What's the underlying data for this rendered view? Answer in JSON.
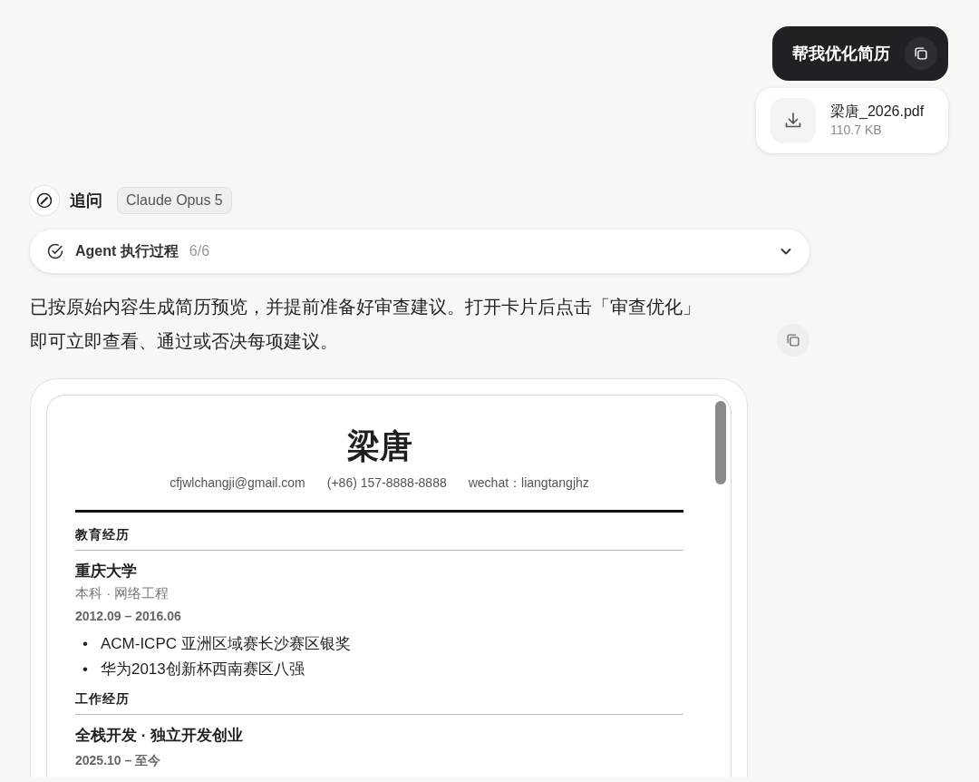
{
  "user_message": {
    "text": "帮我优化简历"
  },
  "attachment": {
    "name": "梁唐_2026.pdf",
    "size": "110.7 KB"
  },
  "assistant": {
    "label": "追问",
    "model": "Claude Opus 5",
    "process": {
      "label": "Agent 执行过程",
      "progress": "6/6",
      "completed": true,
      "expanded": false
    },
    "message": [
      "已按原始内容生成简历预览，并提前准备好审查建议。打开卡片后点击「审查优化」",
      "即可立即查看、通过或否决每项建议。"
    ],
    "resume": {
      "name": "梁唐",
      "contacts": [
        "cfjwlchangji@gmail.com",
        "(+86) 157-8888-8888",
        "wechat：liangtangjhz"
      ],
      "sections": [
        {
          "title": "教育经历",
          "entries": [
            {
              "title": "重庆大学",
              "subtitle": "本科 · 网络工程",
              "dates": "2012.09 – 2016.06",
              "bullets": [
                {
                  "marker": "•",
                  "text": "ACM-ICPC 亚洲区域赛长沙赛区银奖"
                },
                {
                  "marker": "•",
                  "text": "华为2013创新杯西南赛区八强"
                }
              ]
            }
          ]
        },
        {
          "title": "工作经历",
          "entries": [
            {
              "title": "全栈开发 · 独立开发创业",
              "dates": "2025.10 – 至今"
            }
          ]
        }
      ]
    }
  }
}
